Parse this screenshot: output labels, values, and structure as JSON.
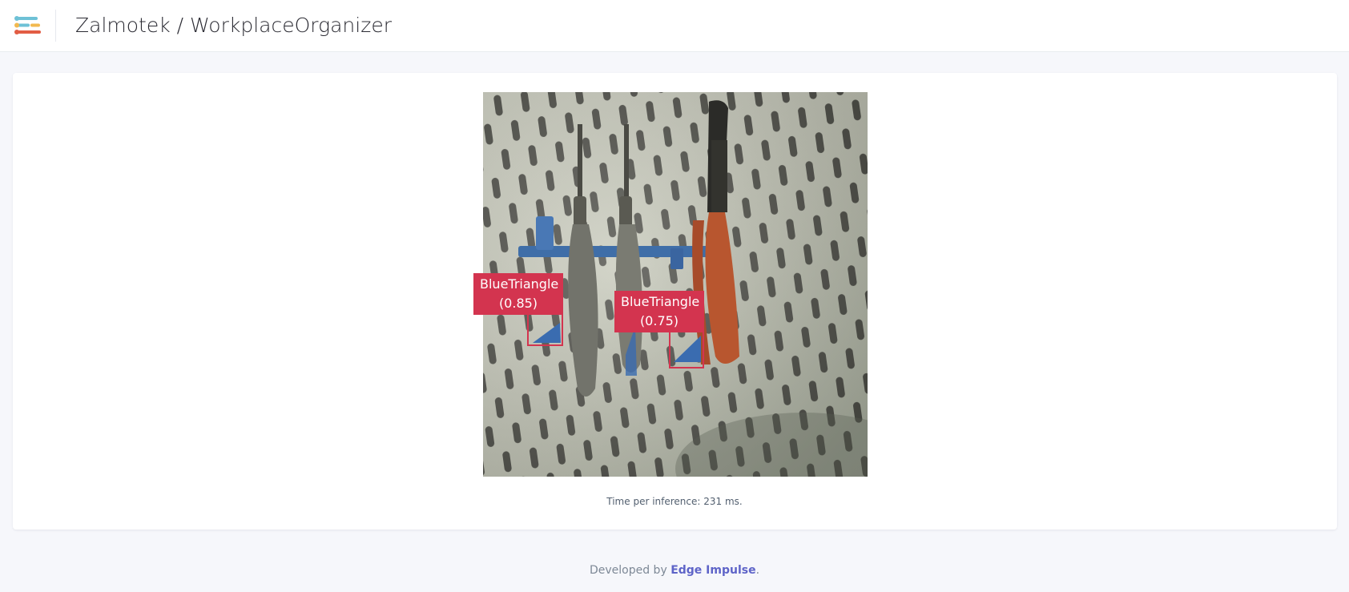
{
  "header": {
    "title": "Zalmotek / WorkplaceOrganizer",
    "logo_colors": [
      "#6ec1d6",
      "#f2b950",
      "#e25d44"
    ]
  },
  "camera": {
    "detections": [
      {
        "label": "BlueTriangle",
        "score": "(0.85)"
      },
      {
        "label": "BlueTriangle",
        "score": "(0.75)"
      }
    ],
    "box_color": "#d3344f"
  },
  "inference": {
    "text": "Time per inference: 231 ms."
  },
  "footer": {
    "prefix": "Developed by",
    "link": "Edge Impulse",
    "suffix": ".",
    "link_color": "#5e64c8"
  }
}
